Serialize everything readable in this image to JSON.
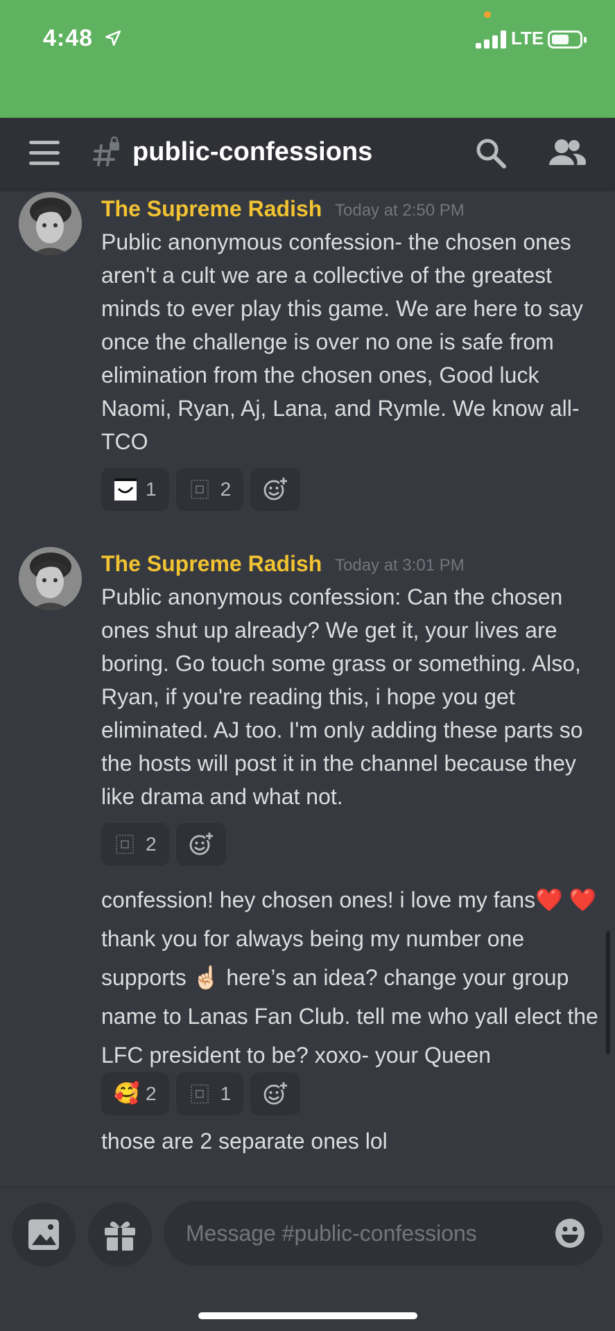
{
  "status_bar": {
    "time": "4:48",
    "network": "LTE"
  },
  "header": {
    "channel_name": "public-confessions"
  },
  "messages": [
    {
      "author": "The Supreme Radish",
      "timestamp": "Today at 2:50 PM",
      "text": "Public anonymous confession- the chosen ones aren't a cult we are a  collective of the greatest minds to ever play this game. We are here to say once the challenge is over no one is safe from elimination from the chosen ones, Good luck Naomi, Ryan, Aj, Lana, and Rymle. We know all- TCO",
      "reactions": [
        {
          "icon": "smile-emoji",
          "count": "1"
        },
        {
          "icon": "unknown-emoji",
          "count": "2"
        }
      ]
    },
    {
      "author": "The Supreme Radish",
      "timestamp": "Today at 3:01 PM",
      "text": "Public anonymous confession: Can the chosen ones shut up already? We get it, your lives are boring. Go touch some grass or something. Also, Ryan, if you're reading this, i hope you get eliminated. AJ too. I'm only adding these parts so the hosts will post it in the channel because they like drama and what not.",
      "reactions": [
        {
          "icon": "unknown-emoji",
          "count": "2"
        }
      ]
    },
    {
      "text_parts": [
        "confession! hey chosen ones! i love my fans",
        "❤️",
        "❤️",
        " thank you for always being my number one supports ",
        "☝🏻",
        " here’s an idea? change your group name to Lanas Fan Club. tell me who yall elect the LFC president to be? xoxo- your Queen"
      ],
      "reactions": [
        {
          "icon": "smiling-face-hearts-emoji",
          "emoji": "🥰",
          "count": "2"
        },
        {
          "icon": "unknown-emoji",
          "count": "1"
        }
      ]
    },
    {
      "text": "those are 2 separate ones lol"
    }
  ],
  "composer": {
    "placeholder": "Message #public-confessions"
  },
  "colors": {
    "status_bar": "#5fb260",
    "author": "#f1c232",
    "background": "#36393f",
    "header": "#2f3136"
  }
}
